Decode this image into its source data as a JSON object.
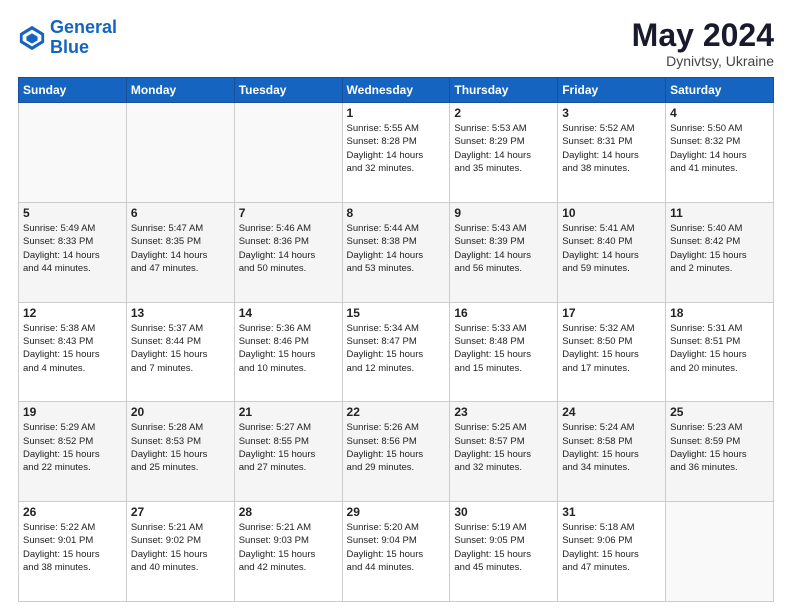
{
  "logo": {
    "line1": "General",
    "line2": "Blue"
  },
  "title": "May 2024",
  "subtitle": "Dynivtsy, Ukraine",
  "days_header": [
    "Sunday",
    "Monday",
    "Tuesday",
    "Wednesday",
    "Thursday",
    "Friday",
    "Saturday"
  ],
  "weeks": [
    [
      {
        "day": "",
        "info": ""
      },
      {
        "day": "",
        "info": ""
      },
      {
        "day": "",
        "info": ""
      },
      {
        "day": "1",
        "info": "Sunrise: 5:55 AM\nSunset: 8:28 PM\nDaylight: 14 hours\nand 32 minutes."
      },
      {
        "day": "2",
        "info": "Sunrise: 5:53 AM\nSunset: 8:29 PM\nDaylight: 14 hours\nand 35 minutes."
      },
      {
        "day": "3",
        "info": "Sunrise: 5:52 AM\nSunset: 8:31 PM\nDaylight: 14 hours\nand 38 minutes."
      },
      {
        "day": "4",
        "info": "Sunrise: 5:50 AM\nSunset: 8:32 PM\nDaylight: 14 hours\nand 41 minutes."
      }
    ],
    [
      {
        "day": "5",
        "info": "Sunrise: 5:49 AM\nSunset: 8:33 PM\nDaylight: 14 hours\nand 44 minutes."
      },
      {
        "day": "6",
        "info": "Sunrise: 5:47 AM\nSunset: 8:35 PM\nDaylight: 14 hours\nand 47 minutes."
      },
      {
        "day": "7",
        "info": "Sunrise: 5:46 AM\nSunset: 8:36 PM\nDaylight: 14 hours\nand 50 minutes."
      },
      {
        "day": "8",
        "info": "Sunrise: 5:44 AM\nSunset: 8:38 PM\nDaylight: 14 hours\nand 53 minutes."
      },
      {
        "day": "9",
        "info": "Sunrise: 5:43 AM\nSunset: 8:39 PM\nDaylight: 14 hours\nand 56 minutes."
      },
      {
        "day": "10",
        "info": "Sunrise: 5:41 AM\nSunset: 8:40 PM\nDaylight: 14 hours\nand 59 minutes."
      },
      {
        "day": "11",
        "info": "Sunrise: 5:40 AM\nSunset: 8:42 PM\nDaylight: 15 hours\nand 2 minutes."
      }
    ],
    [
      {
        "day": "12",
        "info": "Sunrise: 5:38 AM\nSunset: 8:43 PM\nDaylight: 15 hours\nand 4 minutes."
      },
      {
        "day": "13",
        "info": "Sunrise: 5:37 AM\nSunset: 8:44 PM\nDaylight: 15 hours\nand 7 minutes."
      },
      {
        "day": "14",
        "info": "Sunrise: 5:36 AM\nSunset: 8:46 PM\nDaylight: 15 hours\nand 10 minutes."
      },
      {
        "day": "15",
        "info": "Sunrise: 5:34 AM\nSunset: 8:47 PM\nDaylight: 15 hours\nand 12 minutes."
      },
      {
        "day": "16",
        "info": "Sunrise: 5:33 AM\nSunset: 8:48 PM\nDaylight: 15 hours\nand 15 minutes."
      },
      {
        "day": "17",
        "info": "Sunrise: 5:32 AM\nSunset: 8:50 PM\nDaylight: 15 hours\nand 17 minutes."
      },
      {
        "day": "18",
        "info": "Sunrise: 5:31 AM\nSunset: 8:51 PM\nDaylight: 15 hours\nand 20 minutes."
      }
    ],
    [
      {
        "day": "19",
        "info": "Sunrise: 5:29 AM\nSunset: 8:52 PM\nDaylight: 15 hours\nand 22 minutes."
      },
      {
        "day": "20",
        "info": "Sunrise: 5:28 AM\nSunset: 8:53 PM\nDaylight: 15 hours\nand 25 minutes."
      },
      {
        "day": "21",
        "info": "Sunrise: 5:27 AM\nSunset: 8:55 PM\nDaylight: 15 hours\nand 27 minutes."
      },
      {
        "day": "22",
        "info": "Sunrise: 5:26 AM\nSunset: 8:56 PM\nDaylight: 15 hours\nand 29 minutes."
      },
      {
        "day": "23",
        "info": "Sunrise: 5:25 AM\nSunset: 8:57 PM\nDaylight: 15 hours\nand 32 minutes."
      },
      {
        "day": "24",
        "info": "Sunrise: 5:24 AM\nSunset: 8:58 PM\nDaylight: 15 hours\nand 34 minutes."
      },
      {
        "day": "25",
        "info": "Sunrise: 5:23 AM\nSunset: 8:59 PM\nDaylight: 15 hours\nand 36 minutes."
      }
    ],
    [
      {
        "day": "26",
        "info": "Sunrise: 5:22 AM\nSunset: 9:01 PM\nDaylight: 15 hours\nand 38 minutes."
      },
      {
        "day": "27",
        "info": "Sunrise: 5:21 AM\nSunset: 9:02 PM\nDaylight: 15 hours\nand 40 minutes."
      },
      {
        "day": "28",
        "info": "Sunrise: 5:21 AM\nSunset: 9:03 PM\nDaylight: 15 hours\nand 42 minutes."
      },
      {
        "day": "29",
        "info": "Sunrise: 5:20 AM\nSunset: 9:04 PM\nDaylight: 15 hours\nand 44 minutes."
      },
      {
        "day": "30",
        "info": "Sunrise: 5:19 AM\nSunset: 9:05 PM\nDaylight: 15 hours\nand 45 minutes."
      },
      {
        "day": "31",
        "info": "Sunrise: 5:18 AM\nSunset: 9:06 PM\nDaylight: 15 hours\nand 47 minutes."
      },
      {
        "day": "",
        "info": ""
      }
    ]
  ]
}
